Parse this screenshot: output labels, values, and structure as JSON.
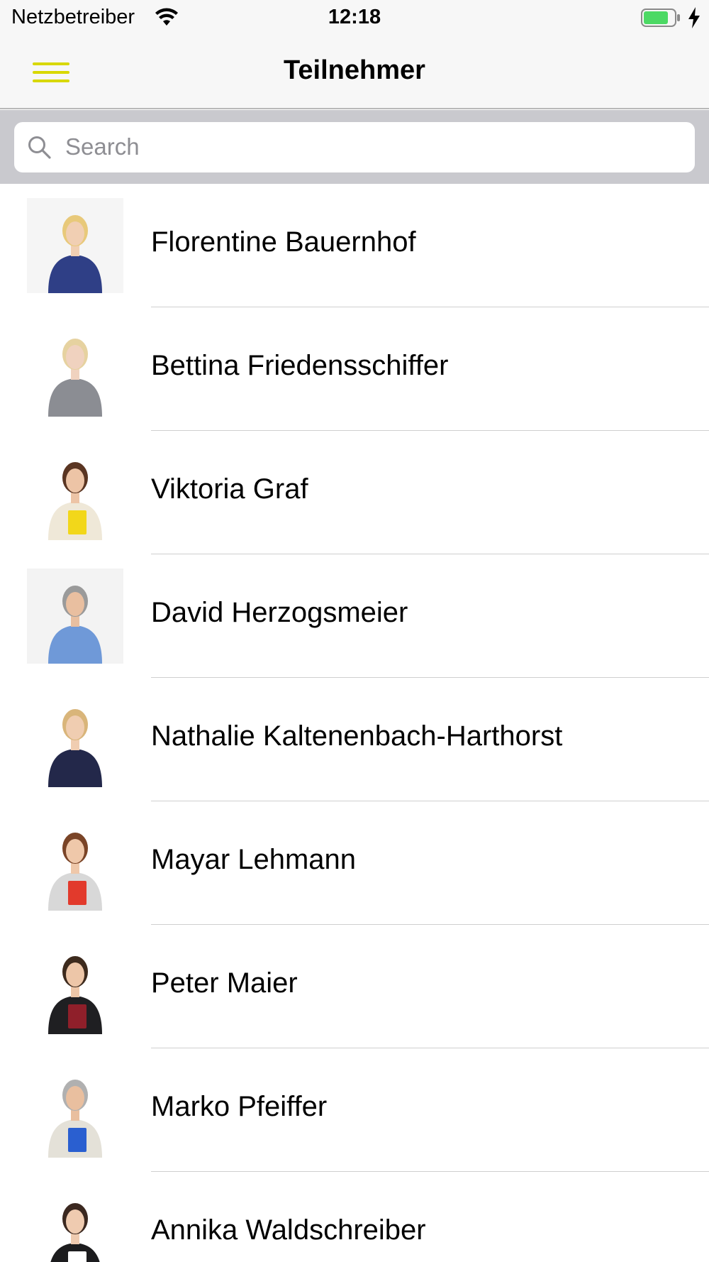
{
  "status_bar": {
    "carrier": "Netzbetreiber",
    "time": "12:18",
    "battery_level": 0.8,
    "charging": true
  },
  "nav": {
    "title": "Teilnehmer",
    "menu_icon": "hamburger-menu-icon",
    "accent_color": "#d8d800"
  },
  "search": {
    "placeholder": "Search",
    "value": ""
  },
  "participants": [
    {
      "name": "Florentine Bauernhof"
    },
    {
      "name": "Bettina Friedensschiffer"
    },
    {
      "name": "Viktoria Graf"
    },
    {
      "name": "David Herzogsmeier"
    },
    {
      "name": "Nathalie Kaltenenbach-Harthorst"
    },
    {
      "name": "Mayar Lehmann"
    },
    {
      "name": "Peter Maier"
    },
    {
      "name": "Marko Pfeiffer"
    },
    {
      "name": "Annika Waldschreiber"
    }
  ]
}
